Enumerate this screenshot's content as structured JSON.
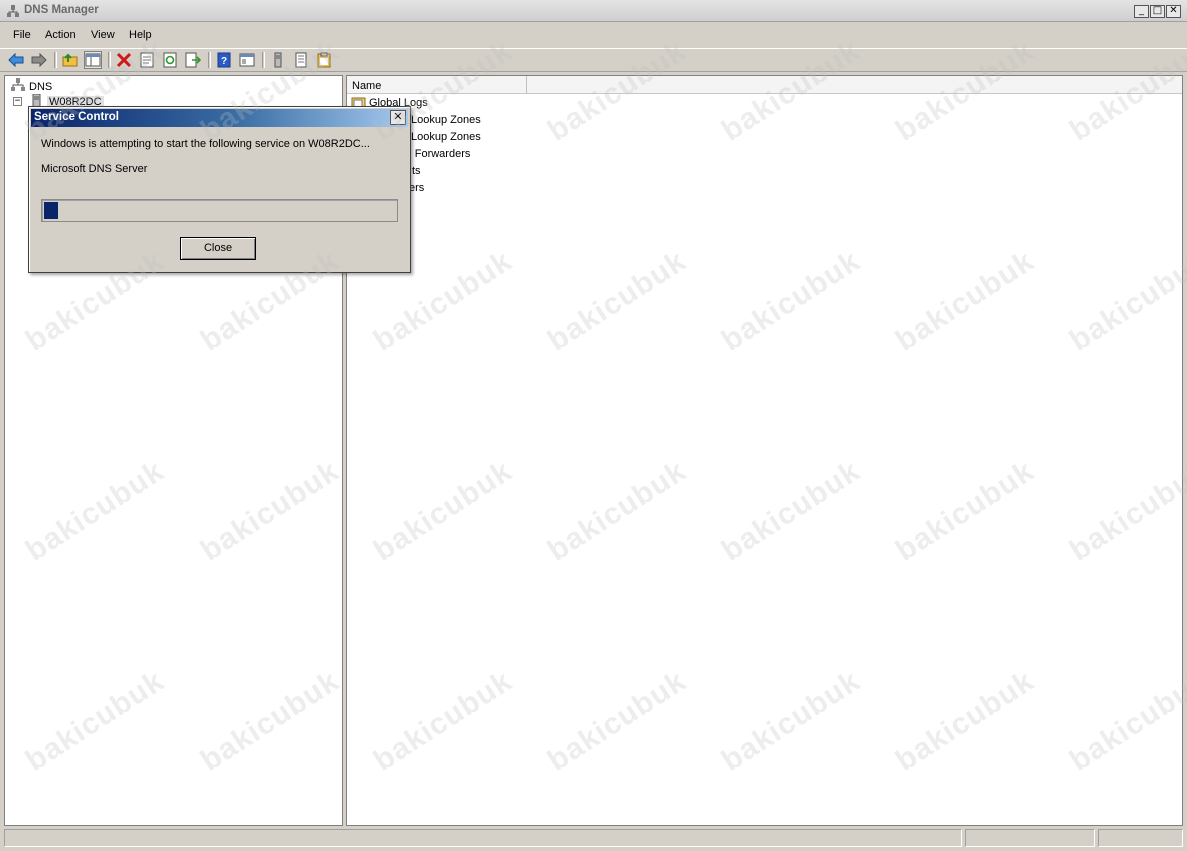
{
  "window": {
    "title": "DNS Manager"
  },
  "window_controls": {
    "minimize": "_",
    "maximize": "□",
    "close": "✕"
  },
  "menu": [
    "File",
    "Action",
    "View",
    "Help"
  ],
  "toolbar_icons": [
    "back-arrow-icon",
    "forward-arrow-icon",
    "up-folder-icon",
    "show-hide-tree-icon",
    "delete-icon",
    "properties-icon",
    "refresh-icon",
    "export-list-icon",
    "help-icon",
    "console-tree-icon",
    "server-icon",
    "list-icon",
    "clipboard-icon"
  ],
  "tree": {
    "root": "DNS",
    "server": "W08R2DC",
    "expander": "−"
  },
  "list": {
    "column_name": "Name",
    "items": [
      {
        "text": "Global Logs"
      },
      {
        "text": "Lookup Zones"
      },
      {
        "text": "Lookup Zones"
      },
      {
        "text": "nal Forwarders"
      },
      {
        "text": "ts"
      },
      {
        "text": "ers"
      }
    ]
  },
  "dialog": {
    "title": "Service Control",
    "close_glyph": "✕",
    "message": "Windows is attempting to start the following service on W08R2DC...",
    "service": "Microsoft DNS Server",
    "progress": 0.04,
    "close_button": "Close"
  },
  "watermark_text": "bakicubuk",
  "colors": {
    "dialog_title": "#0a246a",
    "progress_fill": "#0a246a"
  }
}
